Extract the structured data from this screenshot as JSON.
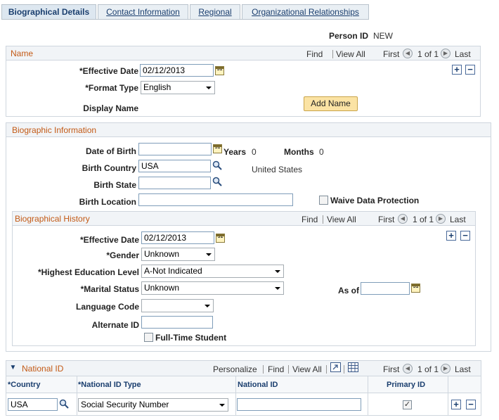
{
  "tabs": [
    {
      "label": "Biographical Details",
      "active": true
    },
    {
      "label": "Contact Information",
      "active": false
    },
    {
      "label": "Regional",
      "active": false
    },
    {
      "label": "Organizational Relationships",
      "active": false
    }
  ],
  "person": {
    "label": "Person ID",
    "value": "NEW"
  },
  "name_section": {
    "title": "Name",
    "find": "Find",
    "view_all": "View All",
    "first": "First",
    "range": "1 of 1",
    "last": "Last",
    "effective_date_label": "*Effective Date",
    "effective_date": "02/12/2013",
    "format_type_label": "*Format Type",
    "format_type": "English",
    "display_name_label": "Display Name",
    "add_name_button": "Add Name"
  },
  "biographic": {
    "title": "Biographic Information",
    "dob_label": "Date of Birth",
    "dob": "",
    "years_label": "Years",
    "years": "0",
    "months_label": "Months",
    "months": "0",
    "birth_country_label": "Birth Country",
    "birth_country": "USA",
    "birth_country_desc": "United States",
    "birth_state_label": "Birth State",
    "birth_state": "",
    "birth_location_label": "Birth Location",
    "birth_location": "",
    "waive_label": "Waive Data Protection"
  },
  "history": {
    "title": "Biographical History",
    "find": "Find",
    "view_all": "View All",
    "first": "First",
    "range": "1 of 1",
    "last": "Last",
    "effective_date_label": "*Effective Date",
    "effective_date": "02/12/2013",
    "gender_label": "*Gender",
    "gender": "Unknown",
    "education_label": "*Highest Education Level",
    "education": "A-Not Indicated",
    "marital_label": "*Marital Status",
    "marital": "Unknown",
    "as_of_label": "As of",
    "as_of": "",
    "language_label": "Language Code",
    "language": "",
    "alt_id_label": "Alternate ID",
    "alt_id": "",
    "fulltime_label": "Full-Time Student"
  },
  "national_id": {
    "title": "National ID",
    "personalize": "Personalize",
    "find": "Find",
    "view_all": "View All",
    "first": "First",
    "range": "1 of 1",
    "last": "Last",
    "columns": {
      "country": "*Country",
      "id_type": "*National ID Type",
      "national_id": "National ID",
      "primary": "Primary ID"
    },
    "row": {
      "country": "USA",
      "id_type": "Social Security Number",
      "national_id": "",
      "primary_checked": "✓"
    }
  }
}
